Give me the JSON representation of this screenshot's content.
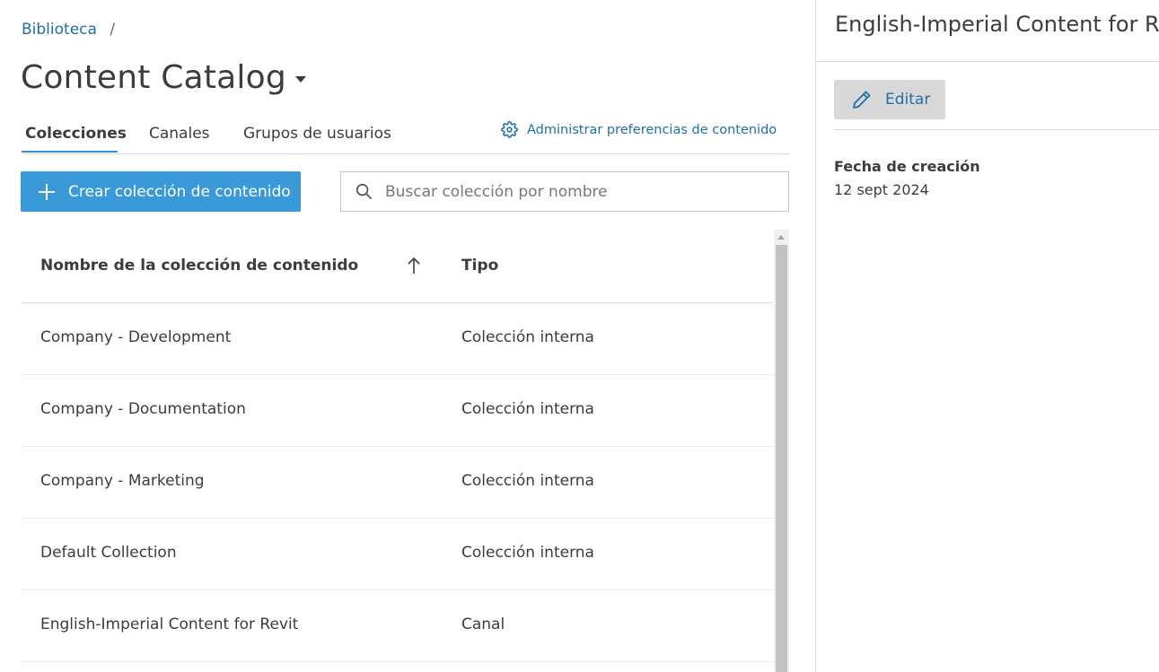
{
  "breadcrumb": {
    "items": [
      "Biblioteca"
    ],
    "separator": "/"
  },
  "page": {
    "title": "Content Catalog"
  },
  "tabs": [
    {
      "label": "Colecciones",
      "active": true
    },
    {
      "label": "Canales",
      "active": false
    },
    {
      "label": "Grupos de usuarios",
      "active": false
    }
  ],
  "manage_prefs": {
    "label": "Administrar preferencias de contenido",
    "icon": "gear-icon"
  },
  "toolbar": {
    "create_label": "Crear colección de contenido"
  },
  "search": {
    "placeholder": "Buscar colección por nombre",
    "value": ""
  },
  "table": {
    "columns": [
      {
        "label": "Nombre de la colección de contenido",
        "sort": "ascending"
      },
      {
        "label": "Tipo"
      }
    ],
    "rows": [
      {
        "name": "Company - Development",
        "type": "Colección interna"
      },
      {
        "name": "Company - Documentation",
        "type": "Colección interna"
      },
      {
        "name": "Company - Marketing",
        "type": "Colección interna"
      },
      {
        "name": "Default Collection",
        "type": "Colección interna"
      },
      {
        "name": "English-Imperial Content for Revit",
        "type": "Canal"
      }
    ]
  },
  "details": {
    "title": "English-Imperial Content for Re",
    "edit_label": "Editar",
    "fields": [
      {
        "label": "Fecha de creación",
        "value": "12 sept 2024"
      }
    ]
  },
  "colors": {
    "accent": "#3a99d9",
    "link": "#1f6fa8",
    "text": "#3c3c3c",
    "divider": "#dcdcdc"
  }
}
